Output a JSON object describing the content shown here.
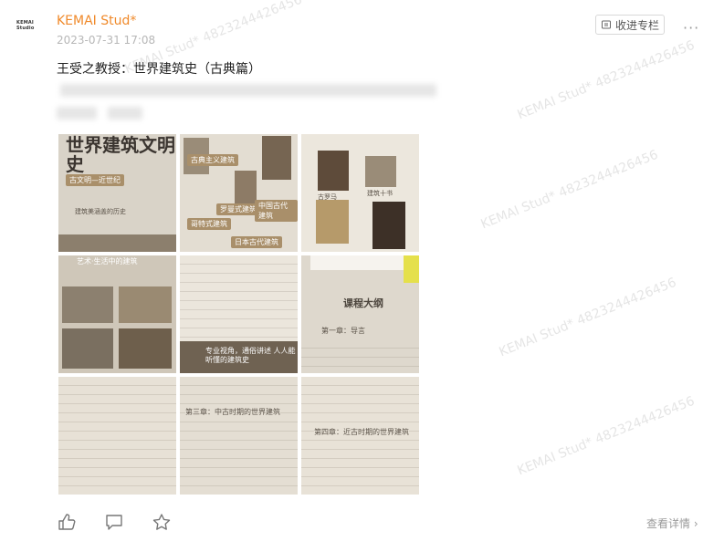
{
  "post": {
    "avatar_text": "KEMAI Studio",
    "author": "KEMAI Stud*",
    "date": "2023-07-31 17:08",
    "collect_label": "收进专栏",
    "more": "···",
    "title": "王受之教授：世界建筑史（古典篇）",
    "view_detail": "查看详情"
  },
  "images": [
    {
      "title": "世界建筑文明史",
      "sub": "古文明—近世纪",
      "caption": "建筑美涵盖的历史"
    },
    {
      "labels": [
        "古典主义建筑",
        "罗曼式建筑",
        "中国古代建筑",
        "日本古代建筑",
        "哥特式建筑"
      ]
    },
    {
      "labels": [
        "古罗马",
        "建筑十书"
      ]
    },
    {
      "title": "艺术·生活中的建筑"
    },
    {
      "caption": "专业视角，通俗讲述 人人能听懂的建筑史"
    },
    {
      "title": "课程大纲",
      "section": "第一章：导言"
    },
    {
      "section": ""
    },
    {
      "section": "第三章：中古时期的世界建筑"
    },
    {
      "section": "第四章：近古时期的世界建筑"
    }
  ],
  "watermark": "KEMAI Stud* 4823244426456",
  "colors": {
    "author": "#f08a2b",
    "muted": "#b7b7b7"
  }
}
